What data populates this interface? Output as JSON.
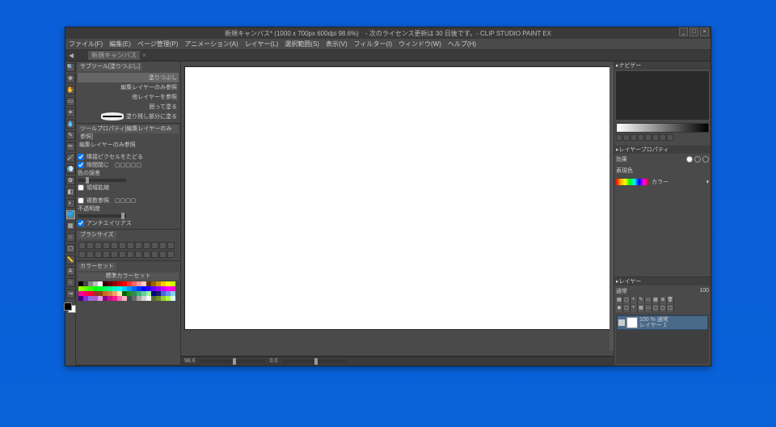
{
  "title": "新規キャンバス* (1000 x 700px 600dpi 98.6%)　- 次のライセンス更新は 30 日後です。- CLIP STUDIO PAINT EX",
  "menu": [
    "ファイル(F)",
    "編集(E)",
    "ページ管理(P)",
    "アニメーション(A)",
    "レイヤー(L)",
    "選択範囲(S)",
    "表示(V)",
    "フィルター(I)",
    "ウィンドウ(W)",
    "ヘルプ(H)"
  ],
  "tab": {
    "label": "新規キャンバス",
    "close": "×"
  },
  "wincontrols": {
    "min": "_",
    "max": "□",
    "close": "×"
  },
  "subtool": {
    "tab": "サブツール[塗りつぶし]",
    "items": [
      "塗りつぶし",
      "編集レイヤーのみ参照",
      "他レイヤーを参照",
      "囲って塗る",
      "塗り残し部分に塗る"
    ]
  },
  "toolprop": {
    "tab": "ツールプロパティ[編集レイヤーのみ参照]",
    "head": "編集レイヤーのみ参照",
    "chk1": "隣接ピクセルをたどる",
    "chk2": "隙間閉じ",
    "lbl1": "色の誤差",
    "chk3": "領域拡縮",
    "chk4": "複数参照",
    "lbl2": "不透明度",
    "chk5": "アンチエイリアス"
  },
  "brush": {
    "tab": "ブラシサイズ"
  },
  "colorset": {
    "tab": "カラーセット",
    "head": "標準カラーセット"
  },
  "navi": {
    "tab": "ナビゲー"
  },
  "layerprop": {
    "tab": "レイヤープロパティ",
    "fx": "効果",
    "expr": "表現色",
    "mode": "カラー"
  },
  "layers": {
    "tab": "レイヤー",
    "blend": "通常",
    "opacity": "100",
    "l1a": "100 % 通常",
    "l1b": "レイヤー 1"
  },
  "status": {
    "zoom": "98.6",
    "angle": "0.0"
  },
  "swatch_colors": [
    "#000",
    "#444",
    "#888",
    "#bbb",
    "#fff",
    "#300",
    "#600",
    "#900",
    "#c00",
    "#f00",
    "#f33",
    "#f66",
    "#f99",
    "#fcc",
    "#630",
    "#960",
    "#c90",
    "#fc0",
    "#ff0",
    "#cf0",
    "#9f0",
    "#6f0",
    "#3f0",
    "#0f0",
    "#0f3",
    "#0f6",
    "#0f9",
    "#0fc",
    "#0ff",
    "#0cf",
    "#09f",
    "#06f",
    "#03f",
    "#00f",
    "#30f",
    "#60f",
    "#90f",
    "#c0f",
    "#f0f",
    "#f0c",
    "#f09",
    "#f06",
    "#f03",
    "#a52a2a",
    "#8b4513",
    "#d2691e",
    "#cd853f",
    "#f4a460",
    "#ffe4b5",
    "#006400",
    "#228b22",
    "#2e8b57",
    "#3cb371",
    "#66cdaa",
    "#98fb98",
    "#00008b",
    "#191970",
    "#4169e1",
    "#6495ed",
    "#87ceeb",
    "#4b0082",
    "#8a2be2",
    "#9370db",
    "#ba55d3",
    "#dda0dd",
    "#8b008b",
    "#c71585",
    "#ff1493",
    "#ff69b4",
    "#ffb6c1",
    "#2f4f4f",
    "#696969",
    "#a9a9a9",
    "#d3d3d3",
    "#f5f5f5",
    "#556b2f",
    "#6b8e23",
    "#9acd32",
    "#adff2f",
    "#e0ffff"
  ]
}
